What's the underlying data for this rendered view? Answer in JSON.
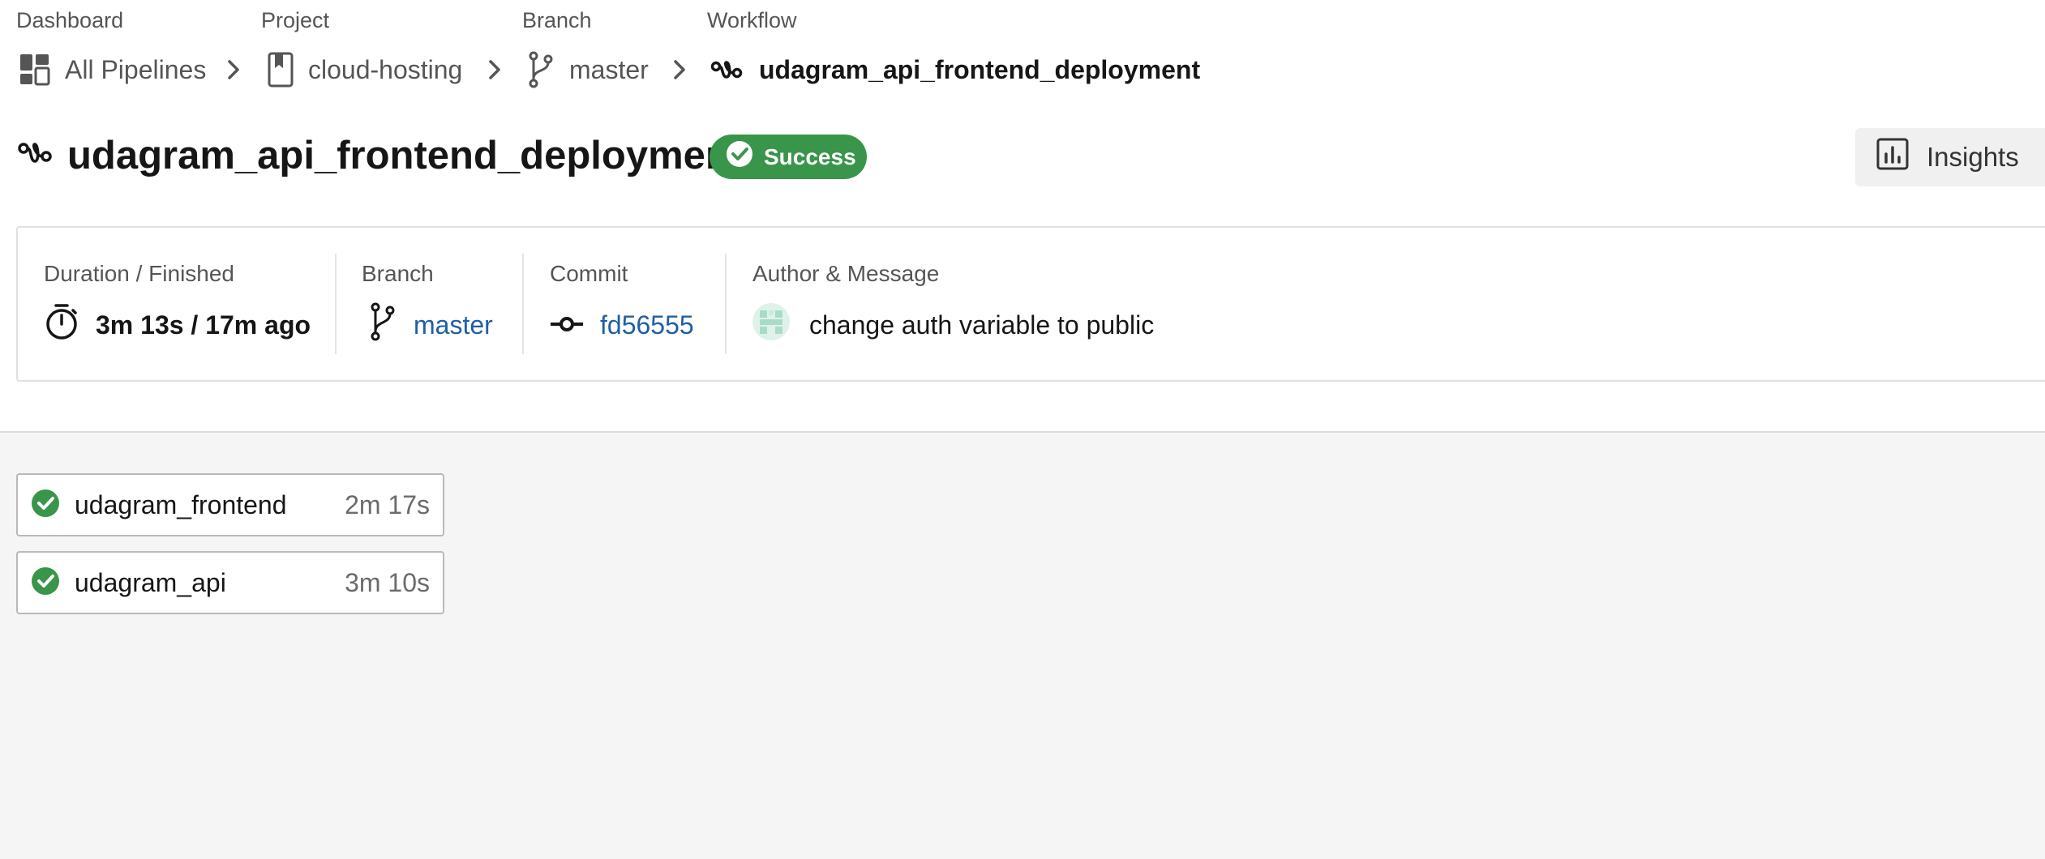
{
  "breadcrumb": {
    "labels": {
      "dashboard": "Dashboard",
      "project": "Project",
      "branch": "Branch",
      "workflow": "Workflow"
    },
    "items": {
      "dashboard": "All Pipelines",
      "project": "cloud-hosting",
      "branch": "master",
      "workflow": "udagram_api_frontend_deployment"
    }
  },
  "header": {
    "title": "udagram_api_frontend_deployment",
    "status": "Success",
    "insights_label": "Insights"
  },
  "summary": {
    "duration_label": "Duration / Finished",
    "duration_value": "3m 13s / 17m ago",
    "branch_label": "Branch",
    "branch_value": "master",
    "commit_label": "Commit",
    "commit_value": "fd56555",
    "author_label": "Author & Message",
    "message": "change auth variable to public"
  },
  "jobs": [
    {
      "name": "udagram_frontend",
      "duration": "2m 17s",
      "status": "success"
    },
    {
      "name": "udagram_api",
      "duration": "3m 10s",
      "status": "success"
    }
  ],
  "colors": {
    "success": "#39954a",
    "link": "#1e5fa6",
    "avatar": "#a8dcc8"
  },
  "icons": {
    "dashboard": "dashboard-grid-icon",
    "project": "bookmark-icon",
    "branch": "git-branch-icon",
    "workflow": "workflow-icon",
    "timer": "stopwatch-icon",
    "commit": "git-commit-icon",
    "insights": "bar-chart-icon",
    "success": "check-circle-icon",
    "separator": "chevron-right-icon"
  }
}
